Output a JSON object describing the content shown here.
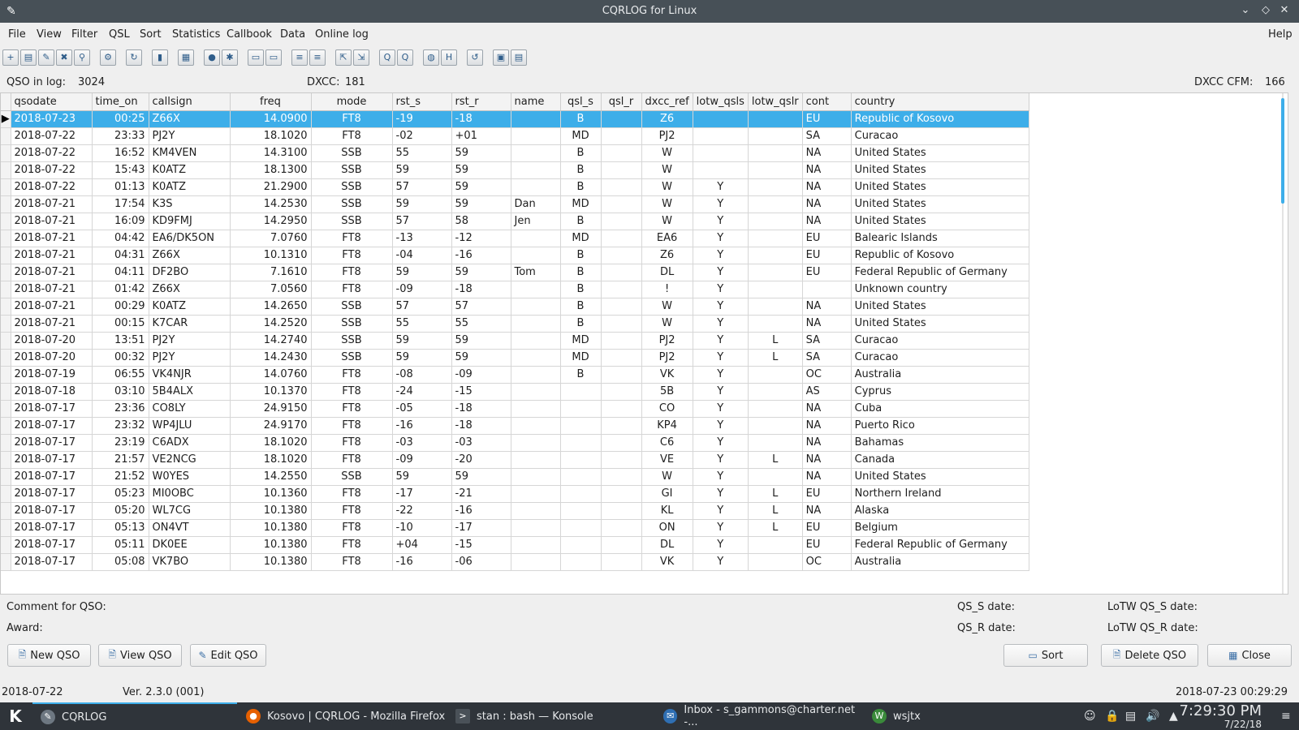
{
  "window": {
    "title": "CQRLOG for Linux"
  },
  "menu": [
    "File",
    "View",
    "Filter",
    "QSL",
    "Sort",
    "Statistics",
    "Callbook",
    "Data",
    "Online log"
  ],
  "help_label": "Help",
  "info": {
    "qso_label": "QSO in log:",
    "qso_value": "3024",
    "dxcc_label": "DXCC:",
    "dxcc_value": "181",
    "cfm_label": "DXCC CFM:",
    "cfm_value": "166"
  },
  "columns": [
    "qsodate",
    "time_on",
    "callsign",
    "freq",
    "mode",
    "rst_s",
    "rst_r",
    "name",
    "qsl_s",
    "qsl_r",
    "dxcc_ref",
    "lotw_qsls",
    "lotw_qslr",
    "cont",
    "country"
  ],
  "rows": [
    [
      "2018-07-23",
      "00:25",
      "Z66X",
      "14.0900",
      "FT8",
      "-19",
      "-18",
      "",
      "B",
      "",
      "Z6",
      "",
      "",
      "EU",
      "Republic of Kosovo"
    ],
    [
      "2018-07-22",
      "23:33",
      "PJ2Y",
      "18.1020",
      "FT8",
      "-02",
      "+01",
      "",
      "MD",
      "",
      "PJ2",
      "",
      "",
      "SA",
      "Curacao"
    ],
    [
      "2018-07-22",
      "16:52",
      "KM4VEN",
      "14.3100",
      "SSB",
      "55",
      "59",
      "",
      "B",
      "",
      "W",
      "",
      "",
      "NA",
      "United States"
    ],
    [
      "2018-07-22",
      "15:43",
      "K0ATZ",
      "18.1300",
      "SSB",
      "59",
      "59",
      "",
      "B",
      "",
      "W",
      "",
      "",
      "NA",
      "United States"
    ],
    [
      "2018-07-22",
      "01:13",
      "K0ATZ",
      "21.2900",
      "SSB",
      "57",
      "59",
      "",
      "B",
      "",
      "W",
      "Y",
      "",
      "NA",
      "United States"
    ],
    [
      "2018-07-21",
      "17:54",
      "K3S",
      "14.2530",
      "SSB",
      "59",
      "59",
      "Dan",
      "MD",
      "",
      "W",
      "Y",
      "",
      "NA",
      "United States"
    ],
    [
      "2018-07-21",
      "16:09",
      "KD9FMJ",
      "14.2950",
      "SSB",
      "57",
      "58",
      "Jen",
      "B",
      "",
      "W",
      "Y",
      "",
      "NA",
      "United States"
    ],
    [
      "2018-07-21",
      "04:42",
      "EA6/DK5ON",
      "7.0760",
      "FT8",
      "-13",
      "-12",
      "",
      "MD",
      "",
      "EA6",
      "Y",
      "",
      "EU",
      "Balearic Islands"
    ],
    [
      "2018-07-21",
      "04:31",
      "Z66X",
      "10.1310",
      "FT8",
      "-04",
      "-16",
      "",
      "B",
      "",
      "Z6",
      "Y",
      "",
      "EU",
      "Republic of Kosovo"
    ],
    [
      "2018-07-21",
      "04:11",
      "DF2BO",
      "7.1610",
      "FT8",
      "59",
      "59",
      "Tom",
      "B",
      "",
      "DL",
      "Y",
      "",
      "EU",
      "Federal Republic of Germany"
    ],
    [
      "2018-07-21",
      "01:42",
      "Z66X",
      "7.0560",
      "FT8",
      "-09",
      "-18",
      "",
      "B",
      "",
      "!",
      "Y",
      "",
      "",
      "Unknown country"
    ],
    [
      "2018-07-21",
      "00:29",
      "K0ATZ",
      "14.2650",
      "SSB",
      "57",
      "57",
      "",
      "B",
      "",
      "W",
      "Y",
      "",
      "NA",
      "United States"
    ],
    [
      "2018-07-21",
      "00:15",
      "K7CAR",
      "14.2520",
      "SSB",
      "55",
      "55",
      "",
      "B",
      "",
      "W",
      "Y",
      "",
      "NA",
      "United States"
    ],
    [
      "2018-07-20",
      "13:51",
      "PJ2Y",
      "14.2740",
      "SSB",
      "59",
      "59",
      "",
      "MD",
      "",
      "PJ2",
      "Y",
      "L",
      "SA",
      "Curacao"
    ],
    [
      "2018-07-20",
      "00:32",
      "PJ2Y",
      "14.2430",
      "SSB",
      "59",
      "59",
      "",
      "MD",
      "",
      "PJ2",
      "Y",
      "L",
      "SA",
      "Curacao"
    ],
    [
      "2018-07-19",
      "06:55",
      "VK4NJR",
      "14.0760",
      "FT8",
      "-08",
      "-09",
      "",
      "B",
      "",
      "VK",
      "Y",
      "",
      "OC",
      "Australia"
    ],
    [
      "2018-07-18",
      "03:10",
      "5B4ALX",
      "10.1370",
      "FT8",
      "-24",
      "-15",
      "",
      "",
      "",
      "5B",
      "Y",
      "",
      "AS",
      "Cyprus"
    ],
    [
      "2018-07-17",
      "23:36",
      "CO8LY",
      "24.9150",
      "FT8",
      "-05",
      "-18",
      "",
      "",
      "",
      "CO",
      "Y",
      "",
      "NA",
      "Cuba"
    ],
    [
      "2018-07-17",
      "23:32",
      "WP4JLU",
      "24.9170",
      "FT8",
      "-16",
      "-18",
      "",
      "",
      "",
      "KP4",
      "Y",
      "",
      "NA",
      "Puerto Rico"
    ],
    [
      "2018-07-17",
      "23:19",
      "C6ADX",
      "18.1020",
      "FT8",
      "-03",
      "-03",
      "",
      "",
      "",
      "C6",
      "Y",
      "",
      "NA",
      "Bahamas"
    ],
    [
      "2018-07-17",
      "21:57",
      "VE2NCG",
      "18.1020",
      "FT8",
      "-09",
      "-20",
      "",
      "",
      "",
      "VE",
      "Y",
      "L",
      "NA",
      "Canada"
    ],
    [
      "2018-07-17",
      "21:52",
      "W0YES",
      "14.2550",
      "SSB",
      "59",
      "59",
      "",
      "",
      "",
      "W",
      "Y",
      "",
      "NA",
      "United States"
    ],
    [
      "2018-07-17",
      "05:23",
      "MI0OBC",
      "10.1360",
      "FT8",
      "-17",
      "-21",
      "",
      "",
      "",
      "GI",
      "Y",
      "L",
      "EU",
      "Northern Ireland"
    ],
    [
      "2018-07-17",
      "05:20",
      "WL7CG",
      "10.1380",
      "FT8",
      "-22",
      "-16",
      "",
      "",
      "",
      "KL",
      "Y",
      "L",
      "NA",
      "Alaska"
    ],
    [
      "2018-07-17",
      "05:13",
      "ON4VT",
      "10.1380",
      "FT8",
      "-10",
      "-17",
      "",
      "",
      "",
      "ON",
      "Y",
      "L",
      "EU",
      "Belgium"
    ],
    [
      "2018-07-17",
      "05:11",
      "DK0EE",
      "10.1380",
      "FT8",
      "+04",
      "-15",
      "",
      "",
      "",
      "DL",
      "Y",
      "",
      "EU",
      "Federal Republic of Germany"
    ],
    [
      "2018-07-17",
      "05:08",
      "VK7BO",
      "10.1380",
      "FT8",
      "-16",
      "-06",
      "",
      "",
      "",
      "VK",
      "Y",
      "",
      "OC",
      "Australia"
    ]
  ],
  "details": {
    "comment_label": "Comment for QSO:",
    "award_label": "Award:",
    "qss_label": "QS_S date:",
    "qsr_label": "QS_R date:",
    "lotws_label": "LoTW QS_S date:",
    "lotwr_label": "LoTW QS_R date:"
  },
  "buttons": {
    "new": "New QSO",
    "view": "View QSO",
    "edit": "Edit QSO",
    "sort": "Sort",
    "delete": "Delete QSO",
    "close": "Close"
  },
  "status": {
    "left": "2018-07-22",
    "version": "Ver. 2.3.0 (001)",
    "right": "2018-07-23  00:29:29"
  },
  "taskbar": {
    "tasks": [
      "CQRLOG",
      "Kosovo | CQRLOG - Mozilla Firefox",
      "stan : bash — Konsole",
      "Inbox - s_gammons@charter.net -...",
      "wsjtx"
    ],
    "time": "7:29:30 PM",
    "date": "7/22/18"
  },
  "colors": {
    "selection": "#3daee9",
    "titlebar": "#475057",
    "taskbar": "#2f343a"
  }
}
